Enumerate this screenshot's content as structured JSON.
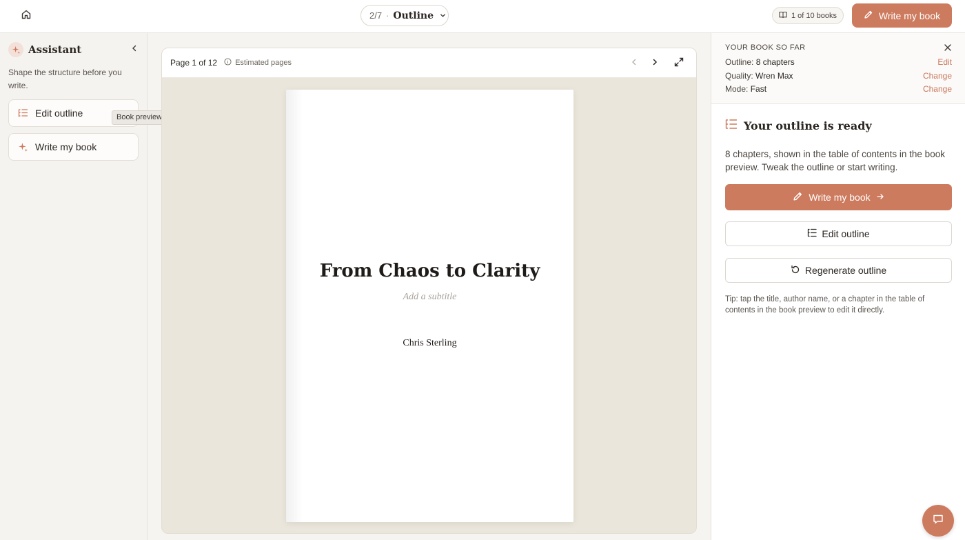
{
  "topbar": {
    "step_number": "2/7",
    "step_name": "Outline",
    "books_count": "1 of 10 books",
    "write_label": "Write my book"
  },
  "sidebar": {
    "title": "Assistant",
    "description": "Shape the structure before you write.",
    "buttons": [
      {
        "label": "Edit outline",
        "icon": "list-icon"
      },
      {
        "label": "Write my book",
        "icon": "sparkle-icon"
      }
    ],
    "tooltip": "Book preview"
  },
  "preview": {
    "page_indicator": "Page 1 of 12",
    "estimated_label": "Estimated pages",
    "book": {
      "title": "From Chaos to Clarity",
      "subtitle_placeholder": "Add a subtitle",
      "author": "Chris Sterling"
    }
  },
  "panel": {
    "summary_title": "YOUR BOOK SO FAR",
    "rows": [
      {
        "label": "Outline:",
        "value": "8 chapters",
        "action": "Edit"
      },
      {
        "label": "Quality:",
        "value": "Wren Max",
        "action": "Change"
      },
      {
        "label": "Mode:",
        "value": "Fast",
        "action": "Change"
      }
    ],
    "ready_title": "Your outline is ready",
    "ready_desc": "8 chapters, shown in the table of contents in the book preview. Tweak the outline or start writing.",
    "primary_label": "Write my book",
    "edit_label": "Edit outline",
    "regen_label": "Regenerate outline",
    "tip": "Tip: tap the title, author name, or a chapter in the table of contents in the book preview to edit it directly."
  },
  "colors": {
    "accent": "#cd7b5f",
    "background": "#f6f4f0"
  }
}
